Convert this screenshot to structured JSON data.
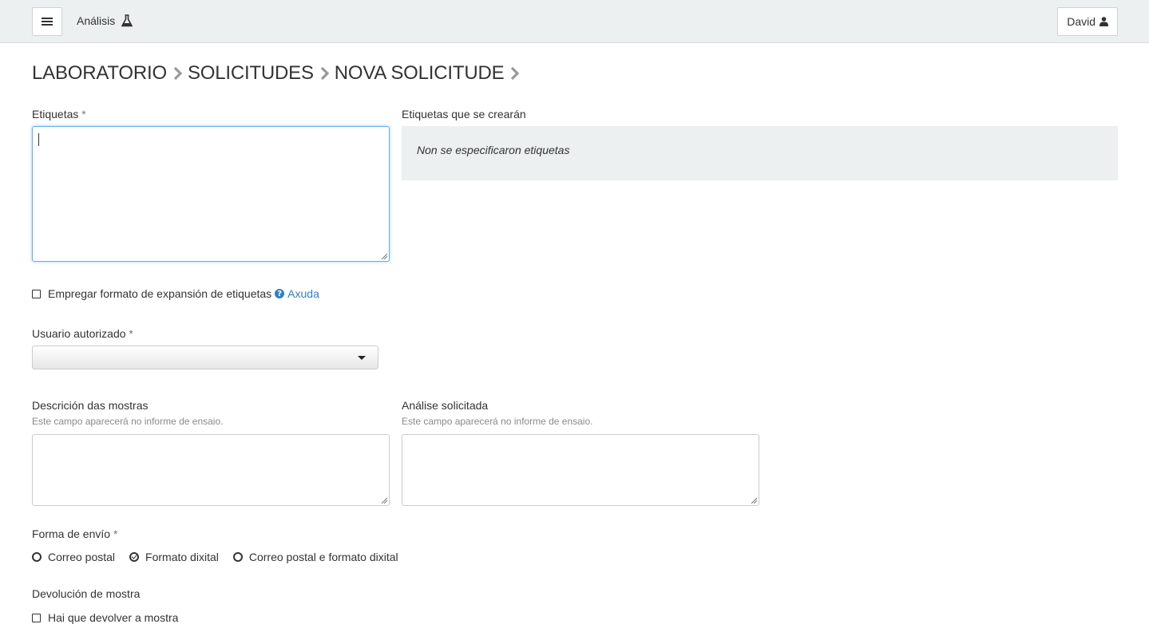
{
  "header": {
    "menu_icon": "hamburger-icon",
    "app_title": "Análisis",
    "app_icon": "flask-icon",
    "user_name": "David",
    "user_icon": "user-icon"
  },
  "breadcrumb": [
    "LABORATORIO",
    "SOLICITUDES",
    "NOVA SOLICITUDE"
  ],
  "form": {
    "labels_field": {
      "label": "Etiquetas",
      "required_mark": "*",
      "value": ""
    },
    "labels_preview": {
      "label": "Etiquetas que se crearán",
      "empty_text": "Non se especificaron etiquetas"
    },
    "expansion_checkbox": {
      "label": "Empregar formato de expansión de etiquetas",
      "checked": false,
      "help_label": "Axuda",
      "help_icon": "question-circle-icon"
    },
    "authorized_user": {
      "label": "Usuario autorizado",
      "required_mark": "*",
      "selected_value": ""
    },
    "samples_description": {
      "label": "Descrición das mostras",
      "help": "Este campo aparecerá no informe de ensaio.",
      "value": ""
    },
    "requested_analysis": {
      "label": "Análise solicitada",
      "help": "Este campo aparecerá no informe de ensaio.",
      "value": ""
    },
    "delivery_method": {
      "label": "Forma de envío",
      "required_mark": "*",
      "options": [
        {
          "label": "Correo postal",
          "checked": false
        },
        {
          "label": "Formato dixital",
          "checked": true
        },
        {
          "label": "Correo postal e formato dixital",
          "checked": false
        }
      ]
    },
    "sample_return": {
      "label": "Devolución de mostra",
      "checkbox_label": "Hai que devolver a mostra",
      "checked": false
    }
  }
}
